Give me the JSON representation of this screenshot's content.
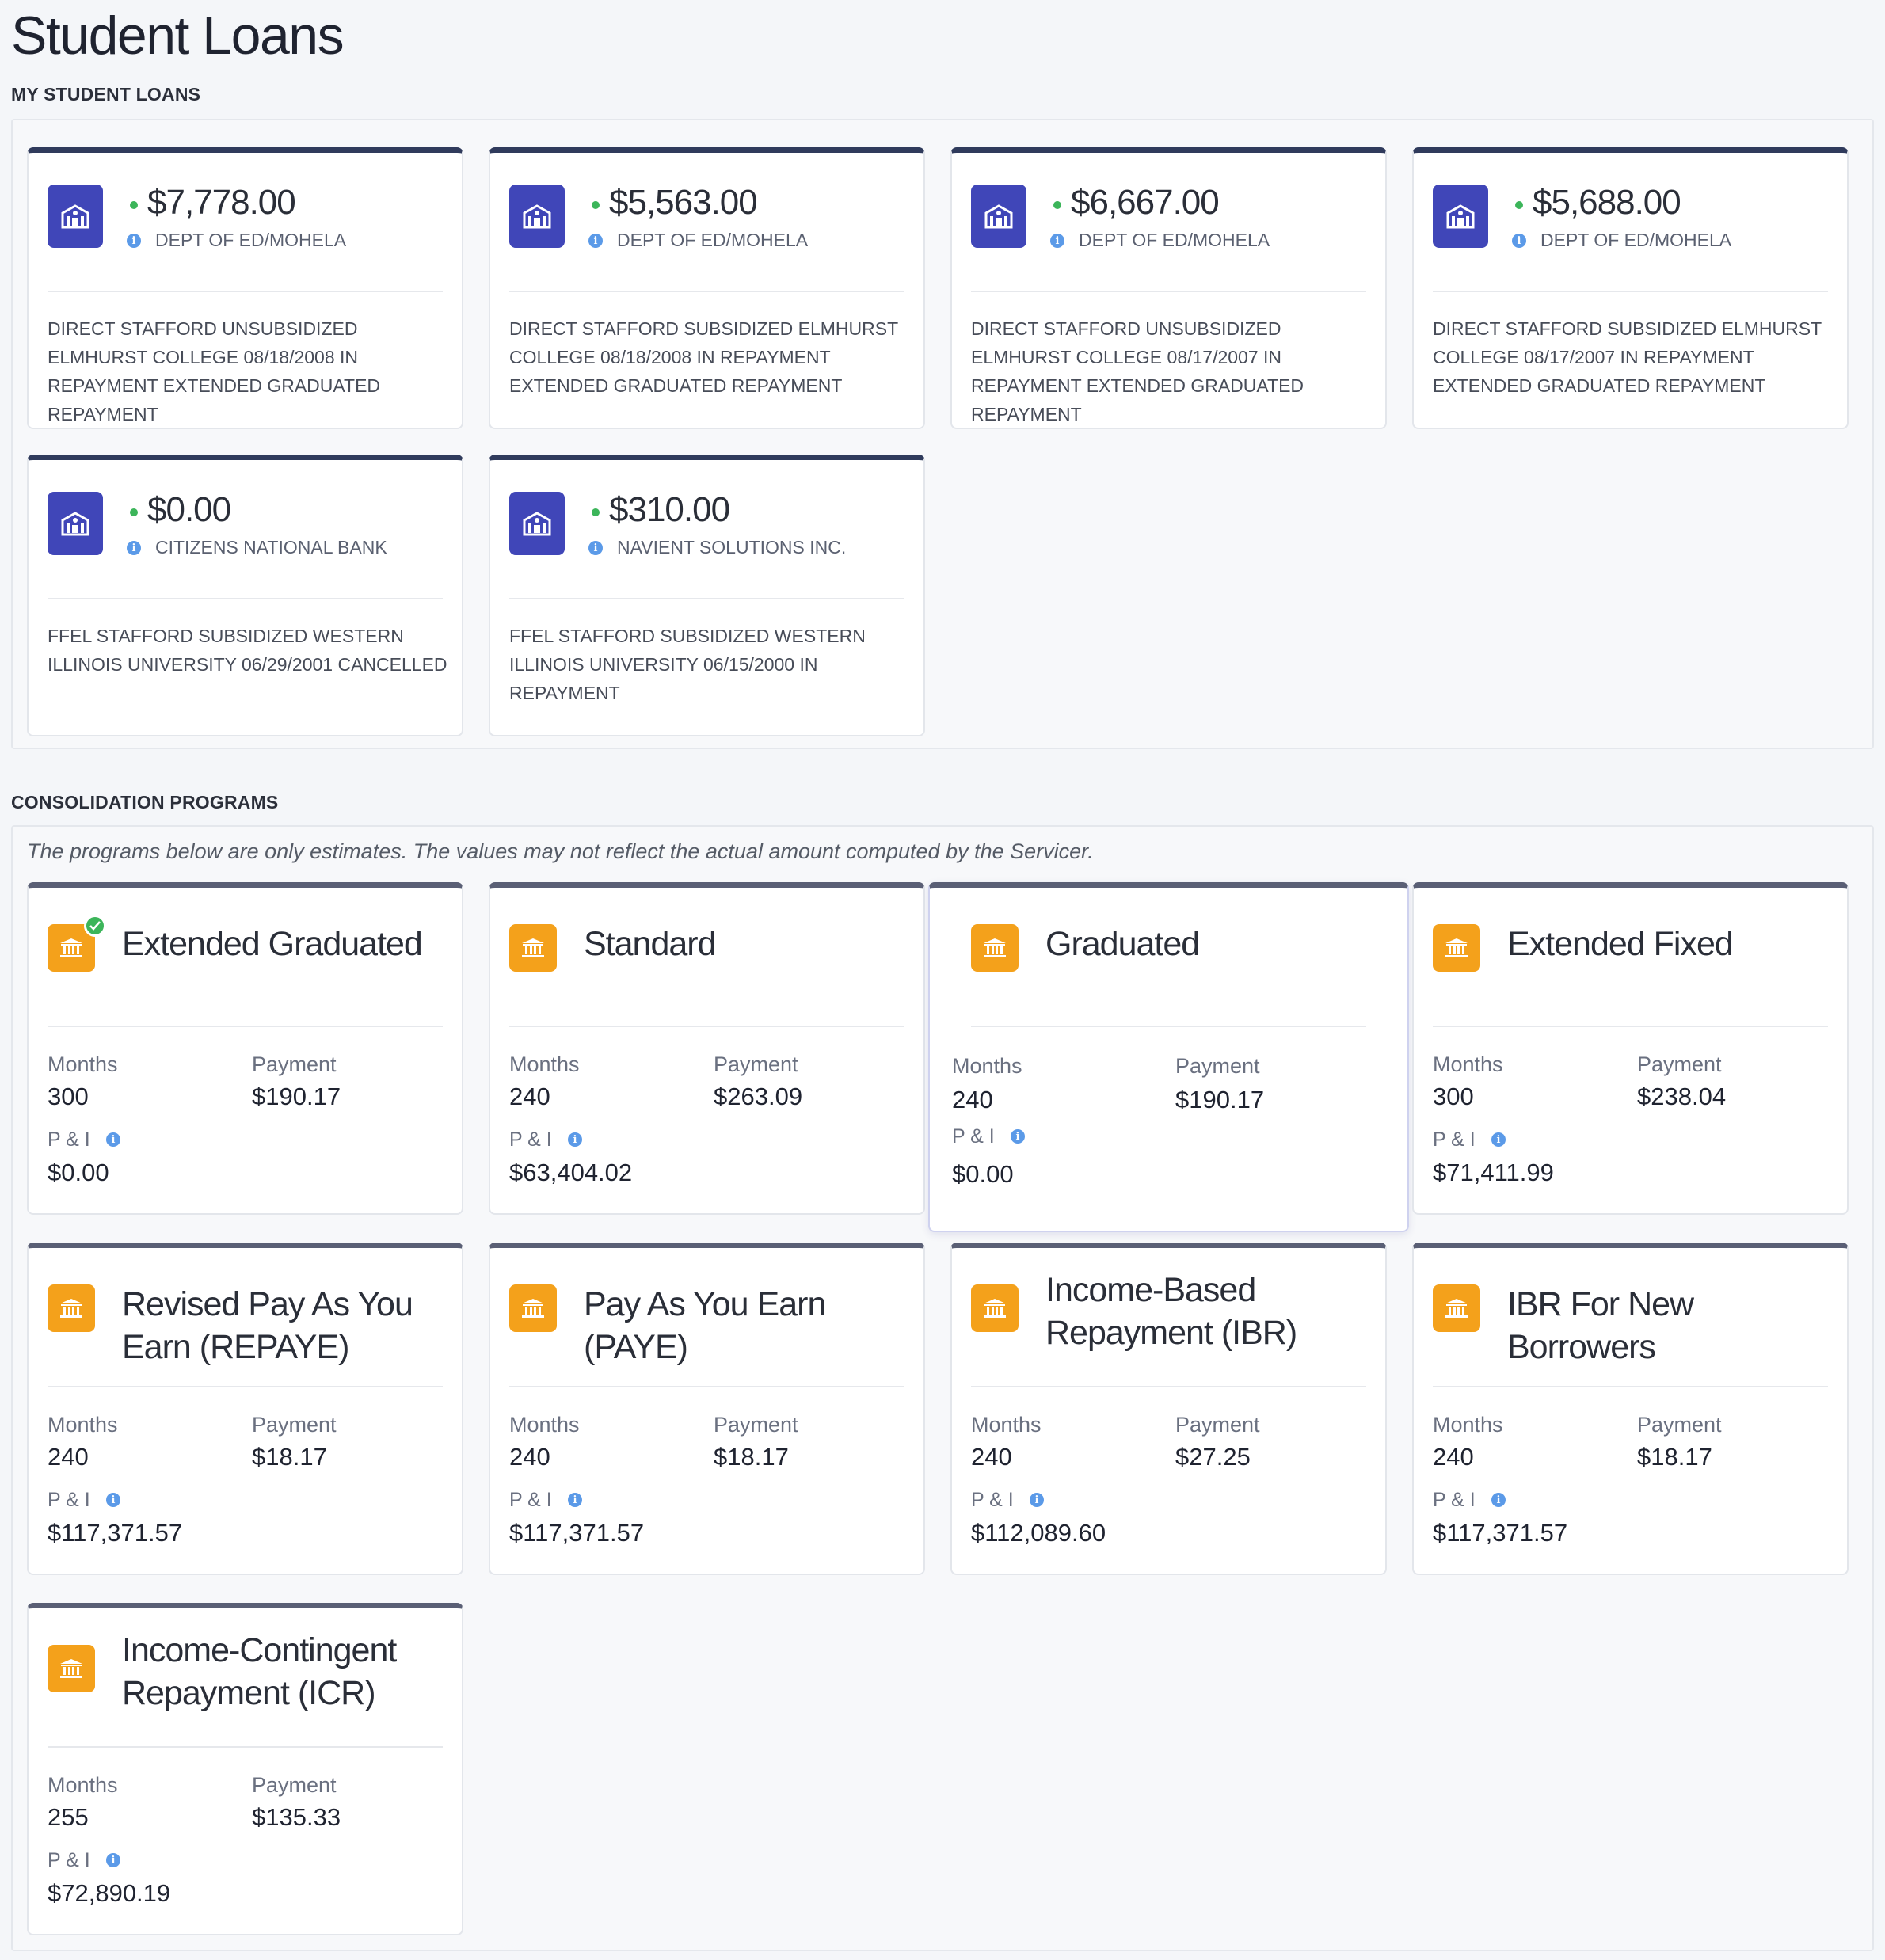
{
  "page": {
    "title": "Student Loans"
  },
  "sections": {
    "loans_title": "MY STUDENT LOANS",
    "programs_title": "CONSOLIDATION PROGRAMS",
    "disclaimer": "The programs below are only estimates. The values may not reflect the actual amount computed by the Servicer."
  },
  "loans": [
    {
      "amount": "$7,778.00",
      "servicer": "DEPT OF ED/MOHELA",
      "description": "DIRECT STAFFORD UNSUBSIDIZED ELMHURST COLLEGE 08/18/2008 IN REPAYMENT EXTENDED GRADUATED REPAYMENT"
    },
    {
      "amount": "$5,563.00",
      "servicer": "DEPT OF ED/MOHELA",
      "description": "DIRECT STAFFORD SUBSIDIZED ELMHURST COLLEGE 08/18/2008 IN REPAYMENT EXTENDED GRADUATED REPAYMENT"
    },
    {
      "amount": "$6,667.00",
      "servicer": "DEPT OF ED/MOHELA",
      "description": "DIRECT STAFFORD UNSUBSIDIZED ELMHURST COLLEGE 08/17/2007 IN REPAYMENT EXTENDED GRADUATED REPAYMENT"
    },
    {
      "amount": "$5,688.00",
      "servicer": "DEPT OF ED/MOHELA",
      "description": "DIRECT STAFFORD SUBSIDIZED ELMHURST COLLEGE 08/17/2007 IN REPAYMENT EXTENDED GRADUATED REPAYMENT"
    },
    {
      "amount": "$0.00",
      "servicer": "CITIZENS NATIONAL BANK",
      "description": "FFEL STAFFORD SUBSIDIZED WESTERN ILLINOIS UNIVERSITY 06/29/2001 CANCELLED"
    },
    {
      "amount": "$310.00",
      "servicer": "NAVIENT SOLUTIONS INC.",
      "description": "FFEL STAFFORD SUBSIDIZED WESTERN ILLINOIS UNIVERSITY 06/15/2000 IN REPAYMENT"
    }
  ],
  "labels": {
    "months": "Months",
    "payment": "Payment",
    "pi": "P & I"
  },
  "programs": [
    {
      "name": "Extended Graduated",
      "months": "300",
      "payment": "$190.17",
      "pi": "$0.00",
      "selected": true
    },
    {
      "name": "Standard",
      "months": "240",
      "payment": "$263.09",
      "pi": "$63,404.02"
    },
    {
      "name": "Graduated",
      "months": "240",
      "payment": "$190.17",
      "pi": "$0.00",
      "hovered": true
    },
    {
      "name": "Extended Fixed",
      "months": "300",
      "payment": "$238.04",
      "pi": "$71,411.99"
    },
    {
      "name": "Revised Pay As You Earn (REPAYE)",
      "months": "240",
      "payment": "$18.17",
      "pi": "$117,371.57"
    },
    {
      "name": "Pay As You Earn (PAYE)",
      "months": "240",
      "payment": "$18.17",
      "pi": "$117,371.57"
    },
    {
      "name": "Income-Based Repayment (IBR)",
      "months": "240",
      "payment": "$27.25",
      "pi": "$112,089.60"
    },
    {
      "name": "IBR For New Borrowers",
      "months": "240",
      "payment": "$18.17",
      "pi": "$117,371.57"
    },
    {
      "name": "Income-Contingent Repayment (ICR)",
      "months": "255",
      "payment": "$135.33",
      "pi": "$72,890.19"
    }
  ],
  "colors": {
    "loan_icon": "#4046b8",
    "program_icon": "#f4a11b",
    "status_dot": "#3cb55a",
    "info_icon": "#5b9ae8",
    "card_top_border": "#303b5c"
  },
  "icons": {
    "loan": "bank-building-icon",
    "program": "bank-columns-icon",
    "info": "info-icon",
    "selected": "check-icon"
  }
}
